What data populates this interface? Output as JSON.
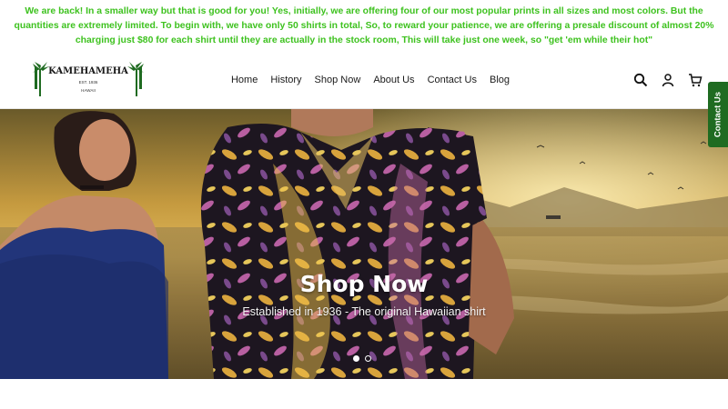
{
  "announcement": {
    "lines": [
      "We are back! In a smaller way but that is good for you! Yes, initially, we are offering four of our most popular prints in all sizes and most colors. But the",
      "quantities are extremely limited. To begin with, we have only 50 shirts in total, So, to reward your patience, we are offering a presale discount of almost 20%",
      "charging just $80 for each shirt until they are actually in the stock room, This will take just one week, so \"get 'em while their hot\""
    ],
    "color": "#3ec21f"
  },
  "logo": {
    "brand": "KAMEHAMEHA",
    "est": "EST. 1936",
    "place": "HAWAII"
  },
  "nav": {
    "items": [
      "Home",
      "History",
      "Shop Now",
      "About Us",
      "Contact Us",
      "Blog"
    ]
  },
  "header_icons": [
    "search-icon",
    "account-icon",
    "cart-icon"
  ],
  "hero": {
    "title": "Shop Now",
    "subtitle": "Established in 1936 - The original Hawaiian shirt",
    "active_slide": 1,
    "slide_count": 2
  },
  "contact_tab": {
    "label": "Contact Us",
    "color": "#1f6b21"
  }
}
